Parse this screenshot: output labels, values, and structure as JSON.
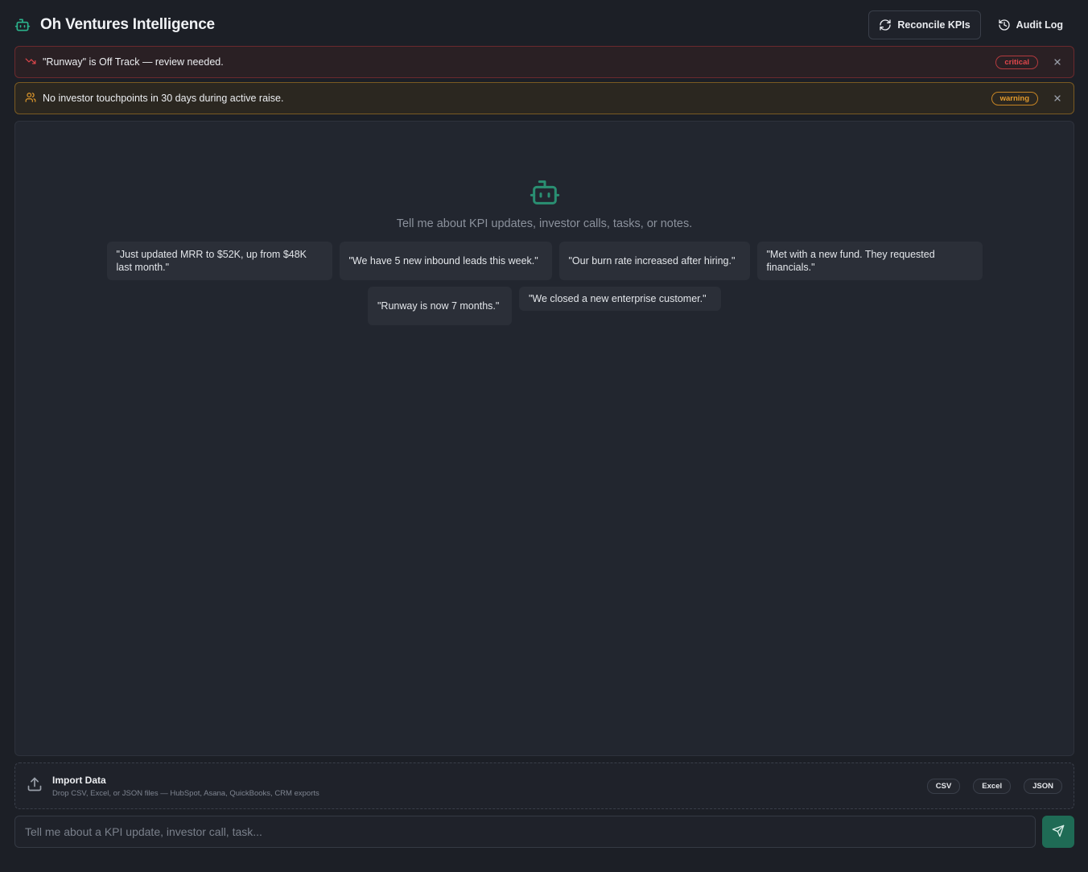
{
  "app": {
    "title": "Oh Ventures Intelligence"
  },
  "header": {
    "reconcile_label": "Reconcile KPIs",
    "audit_label": "Audit Log"
  },
  "alerts": [
    {
      "text": "\"Runway\" is Off Track — review needed.",
      "severity": "critical",
      "icon": "trending-down-icon"
    },
    {
      "text": "No investor touchpoints in 30 days during active raise.",
      "severity": "warning",
      "icon": "users-icon"
    }
  ],
  "chat": {
    "empty_text": "Tell me about KPI updates, investor calls, tasks, or notes.",
    "suggestions": [
      "\"Just updated MRR to $52K, up from $48K last month.\"",
      "\"We have 5 new inbound leads this week.\"",
      "\"Our burn rate increased after hiring.\"",
      "\"Met with a new fund. They requested financials.\"",
      "\"Runway is now 7 months.\"",
      "\"We closed a new enterprise customer.\""
    ]
  },
  "import": {
    "title": "Import Data",
    "subtitle": "Drop CSV, Excel, or JSON files — HubSpot, Asana, QuickBooks, CRM exports",
    "formats": [
      "CSV",
      "Excel",
      "JSON"
    ]
  },
  "composer": {
    "placeholder": "Tell me about a KPI update, investor call, task..."
  },
  "colors": {
    "accent": "#2bb38c",
    "critical": "#e0474c",
    "warning": "#e29a2c",
    "send": "#1f6b55"
  }
}
